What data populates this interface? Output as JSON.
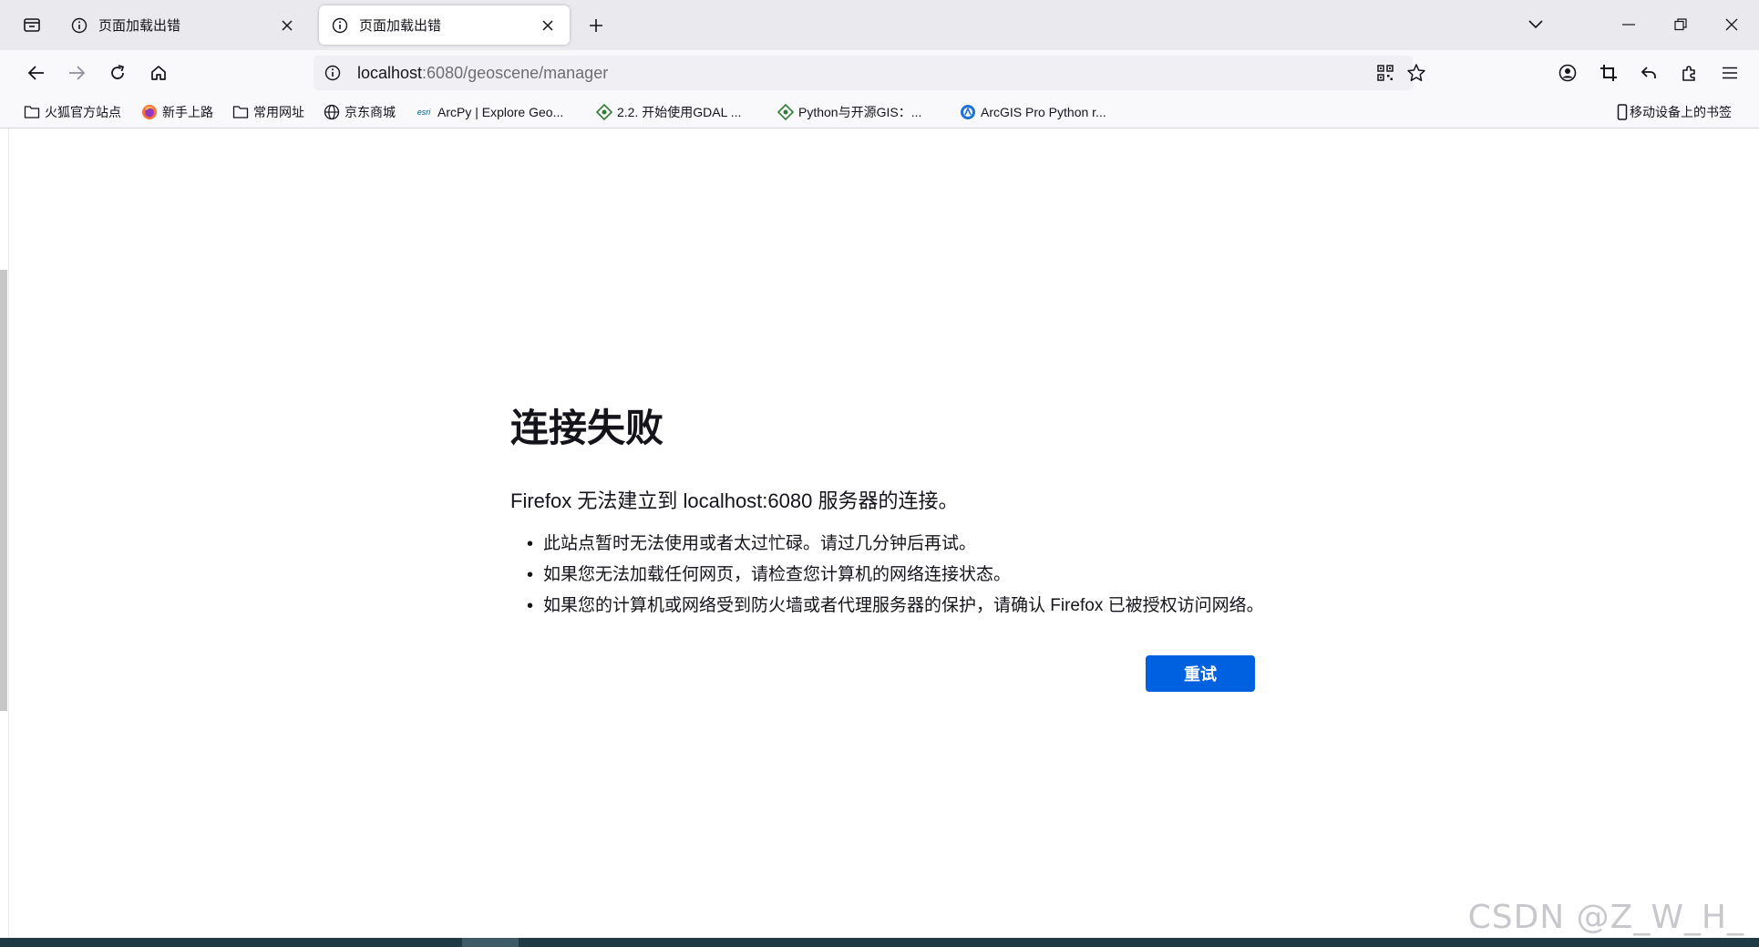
{
  "tabs": [
    {
      "title": "页面加载出错",
      "active": false
    },
    {
      "title": "页面加载出错",
      "active": true
    }
  ],
  "url": {
    "host": "localhost",
    "rest": ":6080/geoscene/manager"
  },
  "bookmarks": [
    {
      "label": "火狐官方站点",
      "icon": "folder-icon"
    },
    {
      "label": "新手上路",
      "icon": "firefox-icon"
    },
    {
      "label": "常用网址",
      "icon": "folder-icon"
    },
    {
      "label": "京东商城",
      "icon": "globe-icon"
    },
    {
      "label": "ArcPy | Explore Geo...",
      "icon": "esri-icon",
      "icon_text": "esri"
    },
    {
      "label": "2.2. 开始使用GDAL ...",
      "icon": "diamond-icon"
    },
    {
      "label": "Python与开源GIS：...",
      "icon": "diamond-icon"
    },
    {
      "label": "ArcGIS Pro Python r...",
      "icon": "arcgis-icon"
    },
    {
      "label": "移动设备上的书签",
      "icon": "mobile-icon"
    }
  ],
  "error": {
    "title": "连接失败",
    "description": "Firefox 无法建立到 localhost:6080 服务器的连接。",
    "items": [
      "此站点暂时无法使用或者太过忙碌。请过几分钟后再试。",
      "如果您无法加载任何网页，请检查您计算机的网络连接状态。",
      "如果您的计算机或网络受到防火墙或者代理服务器的保护，请确认 Firefox 已被授权访问网络。"
    ],
    "retry_label": "重试"
  },
  "watermark": "CSDN @Z_W_H_",
  "colors": {
    "accent": "#0061e0",
    "tabbar": "#e9e9ee",
    "toolbar": "#f9f9fb"
  }
}
